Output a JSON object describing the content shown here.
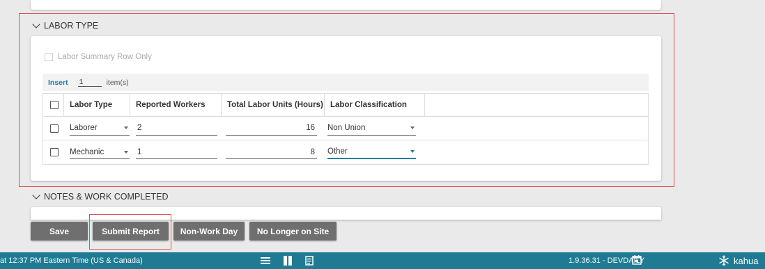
{
  "labor_type": {
    "header": "LABOR TYPE",
    "summary_label": "Labor Summary Row Only",
    "insert": {
      "link": "Insert",
      "qty": "1",
      "items_label": "item(s)"
    },
    "columns": [
      "Labor Type",
      "Reported Workers",
      "Total Labor Units (Hours)",
      "Labor Classification"
    ],
    "rows": [
      {
        "labor_type": "Laborer",
        "workers": "2",
        "hours": "16",
        "classification": "Non Union"
      },
      {
        "labor_type": "Mechanic",
        "workers": "1",
        "hours": "8",
        "classification": "Other"
      }
    ]
  },
  "notes": {
    "header": "NOTES & WORK COMPLETED"
  },
  "buttons": {
    "save": "Save",
    "submit": "Submit Report",
    "non_work": "Non-Work Day",
    "no_longer": "No Longer on Site"
  },
  "footer": {
    "time": "at 12:37 PM Eastern Time (US & Canada)",
    "version": "1.9.36.31 - DEVDAILY",
    "brand": "kahua"
  },
  "colors": {
    "accent": "#1a7fa0",
    "footer_bg": "#1e7b93",
    "highlight": "#d9534f",
    "button": "#6f6f6f"
  }
}
